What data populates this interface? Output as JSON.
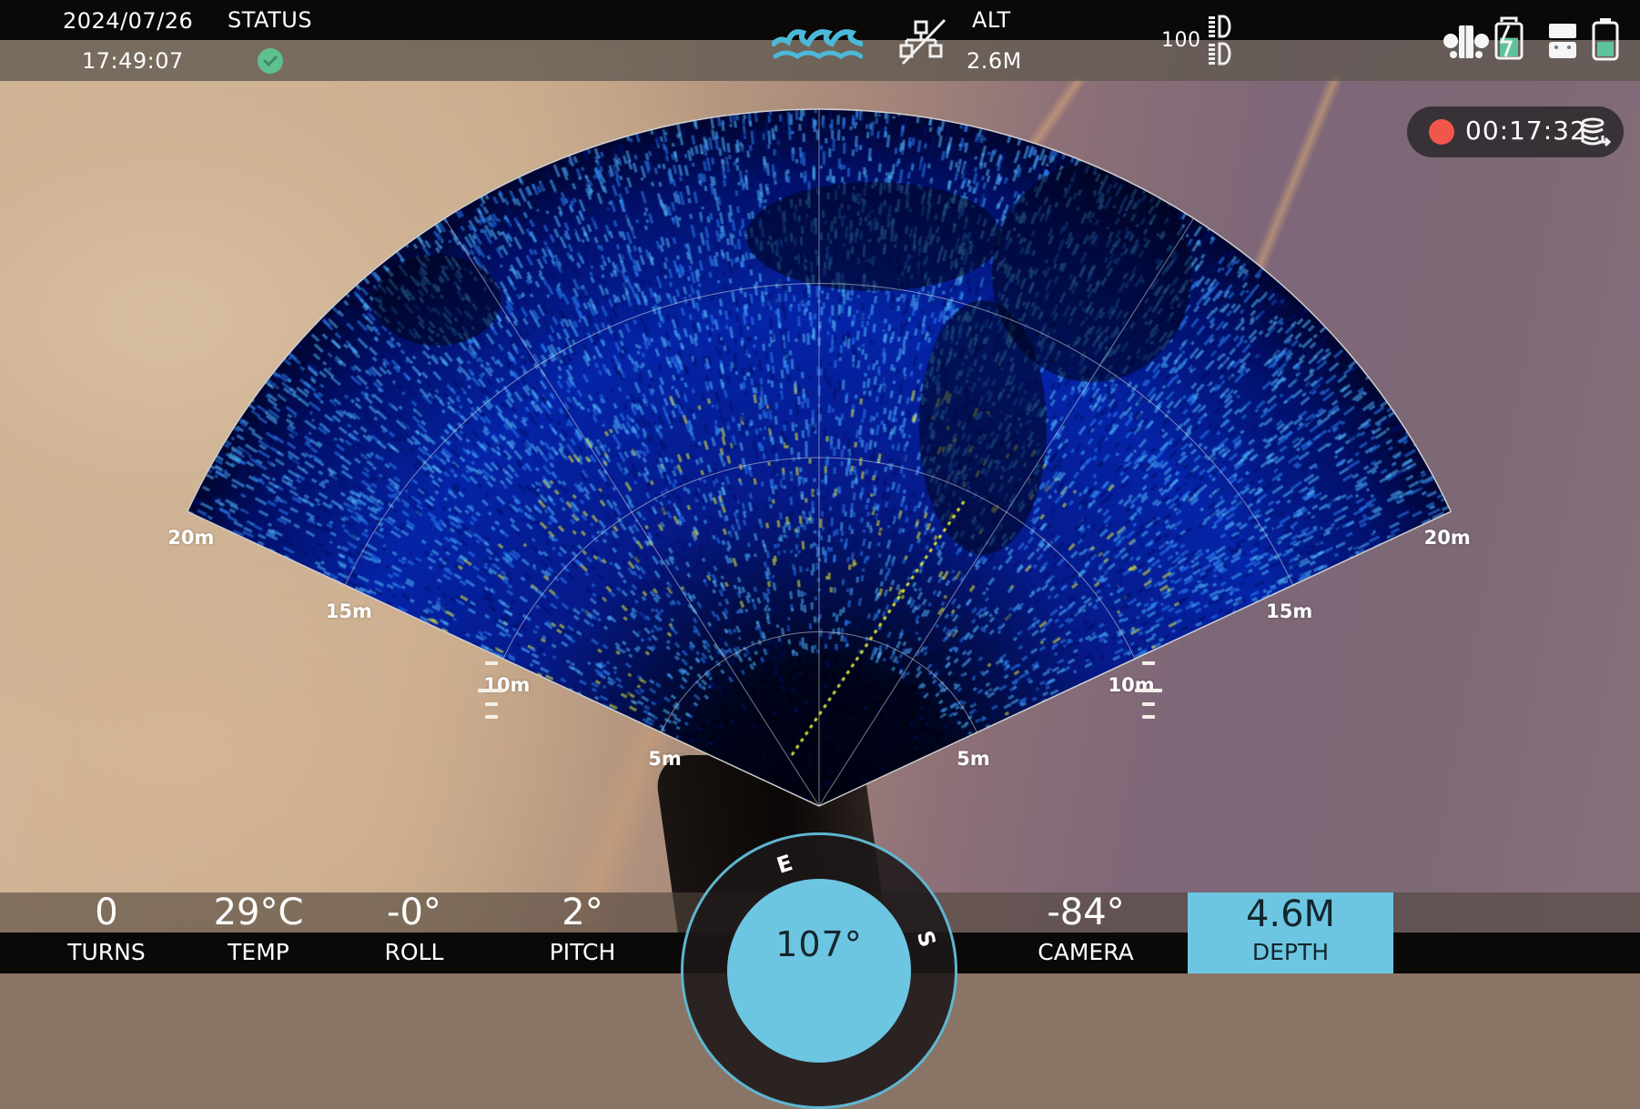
{
  "header": {
    "date": "2024/07/26",
    "time": "17:49:07",
    "status_label": "STATUS",
    "status_icon": "check-circle-icon",
    "status_color": "#5ec08f",
    "water_icon": "water-waves-icon",
    "water_color": "#4cb9d8",
    "network_icon": "network-disconnected-icon",
    "alt_label": "ALT",
    "alt_value": "2.6M",
    "light_value": "100",
    "light_icon": "light-level-icon",
    "right_icons": [
      "thrusters-icon",
      "remote-battery-charging-icon",
      "controller-icon",
      "drone-battery-icon"
    ],
    "remote_battery_level": 0.6,
    "drone_battery_level": 0.45,
    "battery_color": "#5ec39a"
  },
  "recording": {
    "time": "00:17:32",
    "dot_color": "#f0574a",
    "storage_icon": "storage-export-icon"
  },
  "sonar": {
    "max_range_m": 20,
    "ring_step_m": 5,
    "fan_half_angle_deg": 65,
    "range_labels": [
      "5m",
      "10m",
      "15m",
      "20m"
    ],
    "colormap": [
      "#000010",
      "#00106a",
      "#0a3bd0",
      "#2a7cf0",
      "#4fb0f5",
      "#e6ef3a"
    ]
  },
  "stats": [
    {
      "label": "TURNS",
      "value": "0"
    },
    {
      "label": "TEMP",
      "value": "29°C"
    },
    {
      "label": "ROLL",
      "value": "-0°"
    },
    {
      "label": "PITCH",
      "value": "2°"
    },
    {
      "label": "CAMERA",
      "value": "-84°"
    }
  ],
  "depth": {
    "label": "DEPTH",
    "value": "4.6M",
    "color": "#6cc6e2"
  },
  "compass": {
    "heading": "107°",
    "heading_deg": 107,
    "cardinals": [
      "E",
      "S"
    ],
    "color": "#6cc6e2"
  }
}
